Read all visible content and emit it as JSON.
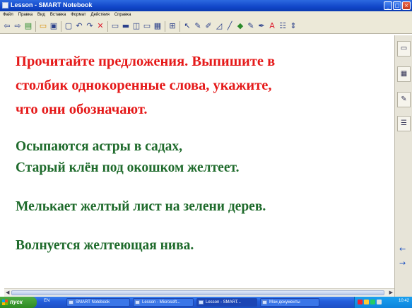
{
  "window": {
    "title": "Lesson - SMART Notebook",
    "buttons": [
      "_",
      "□",
      "×"
    ]
  },
  "menubar": {
    "items": [
      "Файл",
      "Правка",
      "Вид",
      "Вставка",
      "Формат",
      "Действия",
      "Справка"
    ]
  },
  "toolbar": {
    "icons": [
      "back-icon",
      "forward-icon",
      "page-sorter-icon",
      "sep",
      "open-icon",
      "save-icon",
      "sep",
      "paste-icon",
      "undo-icon",
      "redo-icon",
      "delete-icon",
      "sep",
      "screen-shade-icon",
      "full-screen-icon",
      "dual-page-icon",
      "capture-icon",
      "table-icon",
      "sep",
      "select-icon",
      "pen-icon",
      "creative-pen-icon",
      "eraser-icon",
      "line-icon",
      "shape-icon",
      "fill-icon",
      "magic-pen-icon",
      "text-icon",
      "properties-icon",
      "move-toolbar-icon"
    ]
  },
  "content": {
    "task": [
      "Прочитайте предложения. Выпишите в",
      "столбик однокоренные слова, укажите,",
      "что они обозначают."
    ],
    "sentences": [
      "Осыпаются астры в садах,",
      "Старый  клён под окошком желтеет.",
      "Мелькает желтый лист на зелени дерев.",
      "Волнуется желтеющая нива."
    ]
  },
  "sidebar": {
    "tabs": [
      "page-sorter-tab-icon",
      "gallery-tab-icon",
      "attachments-tab-icon",
      "properties-tab-icon"
    ],
    "arrows": [
      "←",
      "→"
    ]
  },
  "taskbar": {
    "start_label": "пуск",
    "quick_launch": "EN",
    "tasks": [
      "SMART Notebook",
      "Lesson - Microsoft...",
      "Lesson - SMART...",
      "Мои документы"
    ],
    "clock": "10:42",
    "colors": {
      "taskbar": "#245edb",
      "start": "#2d8a22",
      "tray": "#0e84dc"
    }
  },
  "colors": {
    "task_text": "#e51a1a",
    "sentence_text": "#1f6b2c"
  }
}
